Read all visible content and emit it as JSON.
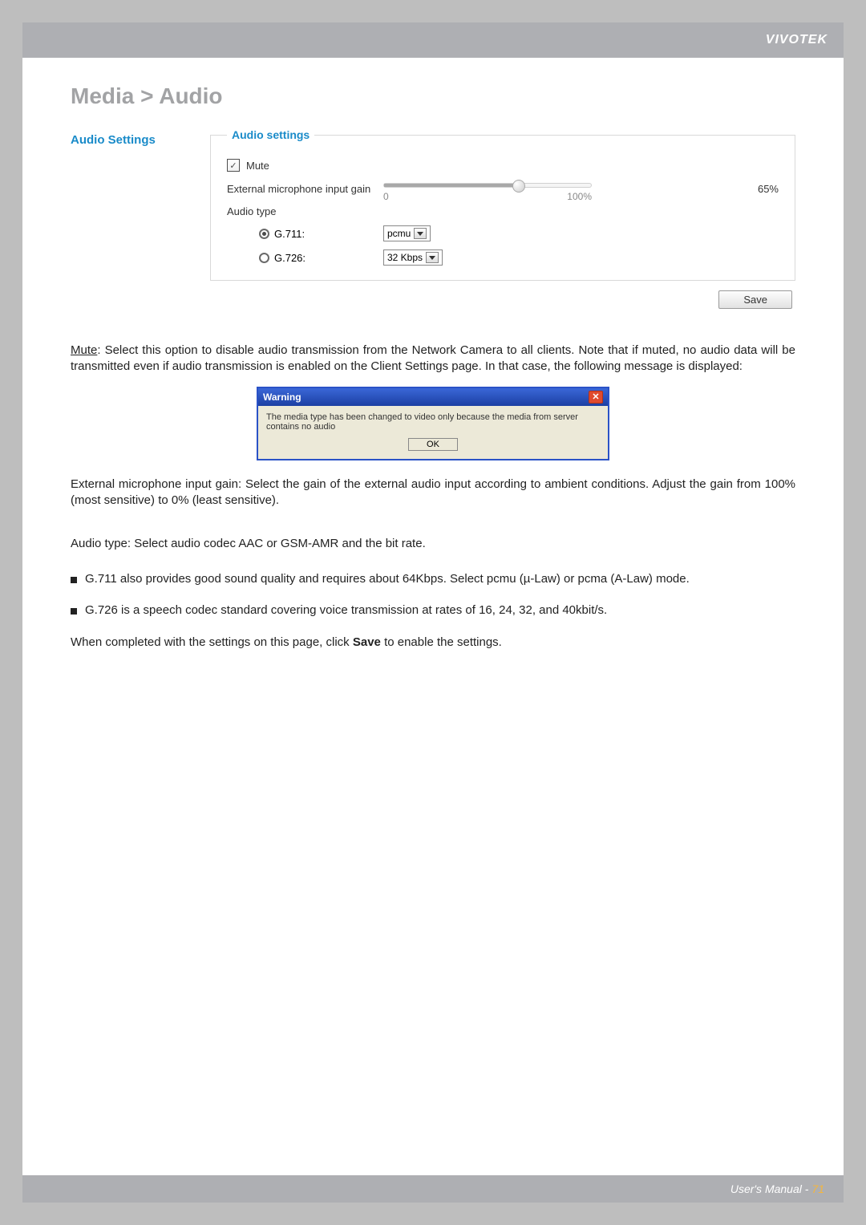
{
  "header": {
    "brand": "VIVOTEK"
  },
  "breadcrumb": "Media > Audio",
  "side_label": "Audio Settings",
  "fieldset": {
    "legend": "Audio settings",
    "mute_label": "Mute",
    "mute_checked": true,
    "gain_label": "External microphone input gain",
    "gain_value": "65%",
    "gain_min": "0",
    "gain_max": "100%",
    "audio_type_label": "Audio type",
    "codec_g711": "G.711:",
    "codec_g726": "G.726:",
    "g711_select": "pcmu",
    "g726_select": "32 Kbps",
    "save_label": "Save"
  },
  "text": {
    "mute_term": "Mute",
    "mute_desc": ": Select this option to disable audio transmission from the Network Camera to all clients. Note that if muted, no audio data will be transmitted even if audio transmission is enabled on the Client Settings page. In that case, the following message is displayed:",
    "dialog_title": "Warning",
    "dialog_msg": "The media type has been changed to video only because the media from server contains no audio",
    "dialog_ok": "OK",
    "gain_term": "External microphone input gain",
    "gain_desc": ": Select the gain of the external audio input according to ambient conditions. Adjust the gain from 100% (most sensitive) to 0% (least sensitive).",
    "type_term": "Audio type",
    "type_desc": ": Select audio codec AAC or GSM-AMR and the bit rate.",
    "bullet1": "G.711 also provides good sound quality and requires about 64Kbps. Select pcmu (µ-Law) or pcma (A-Law) mode.",
    "bullet2": "G.726 is a speech codec standard covering voice transmission at rates of 16, 24, 32, and 40kbit/s.",
    "closing_pre": "When completed with the settings on this page, click ",
    "closing_bold": "Save",
    "closing_post": " to enable the settings."
  },
  "footer": {
    "label": "User's Manual - ",
    "page": "71"
  }
}
